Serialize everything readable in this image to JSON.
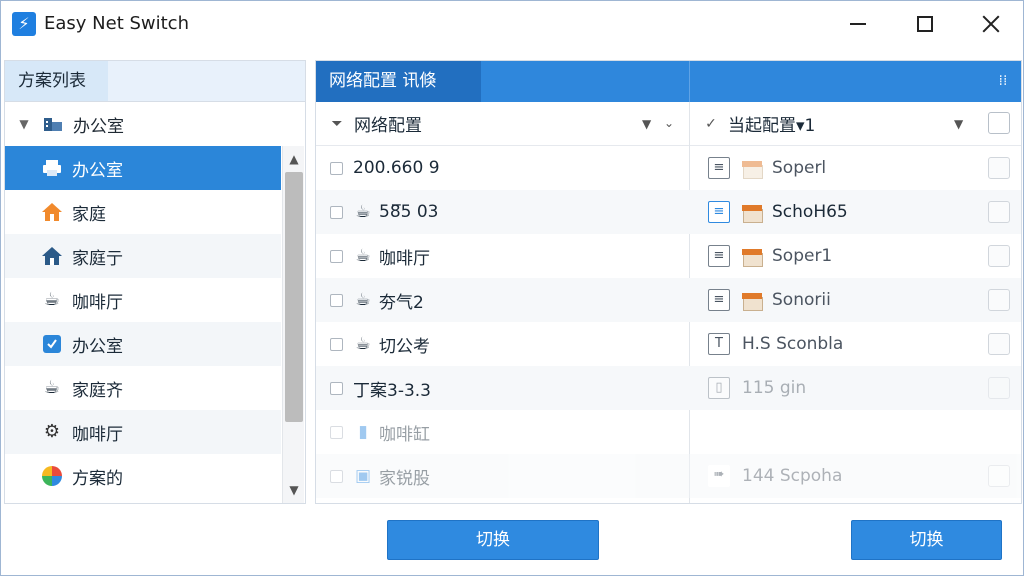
{
  "window": {
    "title": "Easy Net Switch"
  },
  "left_panel": {
    "header": "方案列表",
    "root": {
      "label": "办公室",
      "icon": "office-building-icon"
    },
    "items": [
      {
        "label": "办公室",
        "icon": "printer-icon",
        "selected": true
      },
      {
        "label": "家庭",
        "icon": "home-orange-icon"
      },
      {
        "label": "家庭亍",
        "icon": "home-blue-icon"
      },
      {
        "label": "咖啡厅",
        "icon": "coffee-cup-icon"
      },
      {
        "label": "办公室",
        "icon": "network-app-icon"
      },
      {
        "label": "家庭齐",
        "icon": "coffee-cup-icon"
      },
      {
        "label": "咖啡厅",
        "icon": "gear-icon"
      },
      {
        "label": "方案的",
        "icon": "colorful-pinwheel-icon"
      }
    ]
  },
  "right_panel": {
    "header": "网络配置 讯倏",
    "columns": {
      "network_config": "网络配置",
      "current_config": "当起配置▾1"
    },
    "rows": [
      {
        "left": "200.660 9",
        "left_icon": "",
        "right": "Soperl",
        "right_icon": "server-icon"
      },
      {
        "left": "58̅5 03",
        "left_icon": "coffee-cup-icon",
        "right": "SchoH65",
        "right_icon": "box-icon"
      },
      {
        "left": "咖啡厅",
        "left_icon": "coffee-cup-icon",
        "right": "Soper1",
        "right_icon": "box-icon"
      },
      {
        "left": "夯气2",
        "left_icon": "coffee-cup-icon",
        "right": "Sonorii",
        "right_icon": "box-icon"
      },
      {
        "left": "切公考",
        "left_icon": "coffee-cup-icon",
        "right": "H.S Sconbla",
        "right_icon": "document-icon"
      },
      {
        "left": "丁案3-3.3",
        "left_icon": "",
        "right": "115 gin",
        "right_icon": "document-icon"
      },
      {
        "left": "咖啡缸",
        "left_icon": "tablet-icon",
        "right": "",
        "right_icon": ""
      },
      {
        "left": "家锐股",
        "left_icon": "image-icon",
        "right": "144 Scpoha",
        "right_icon": "arrow-icon"
      }
    ]
  },
  "buttons": {
    "switch_left": "切换",
    "switch_right": "切换"
  }
}
